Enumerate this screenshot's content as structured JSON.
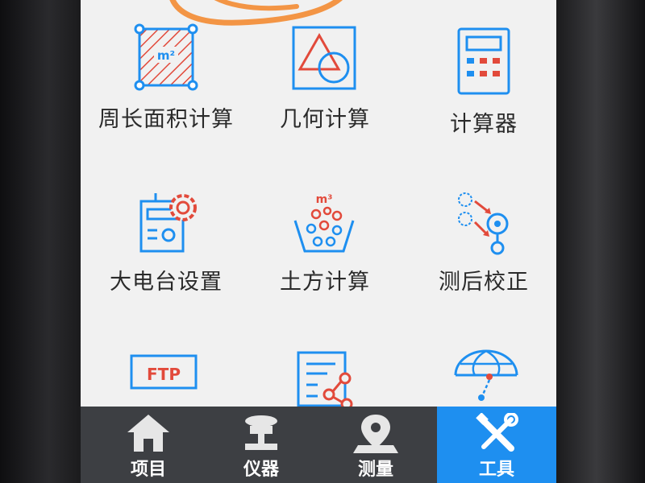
{
  "grid": {
    "items": [
      {
        "label": "周长面积计算",
        "icon": "perimeter-area-icon"
      },
      {
        "label": "几何计算",
        "icon": "geometry-icon"
      },
      {
        "label": "计算器",
        "icon": "calculator-icon"
      },
      {
        "label": "大电台设置",
        "icon": "radio-settings-icon"
      },
      {
        "label": "土方计算",
        "icon": "earthwork-icon"
      },
      {
        "label": "测后校正",
        "icon": "post-survey-correction-icon"
      },
      {
        "label": "",
        "icon": "ftp-icon",
        "icon_text": "FTP"
      },
      {
        "label": "",
        "icon": "document-share-icon"
      },
      {
        "label": "",
        "icon": "globe-antenna-icon"
      }
    ],
    "perimeter_icon_text": "m²",
    "earthwork_icon_text": "m³"
  },
  "tabbar": {
    "tabs": [
      {
        "label": "项目",
        "icon": "home-icon"
      },
      {
        "label": "仪器",
        "icon": "gnss-receiver-icon"
      },
      {
        "label": "测量",
        "icon": "map-pin-icon"
      },
      {
        "label": "工具",
        "icon": "tools-icon"
      }
    ],
    "active_tab": "工具"
  },
  "colors": {
    "accent_blue": "#1e8ff0",
    "icon_red": "#e24a3b",
    "tabbar_bg": "#3d3f43",
    "screen_bg": "#f1f1f1"
  }
}
